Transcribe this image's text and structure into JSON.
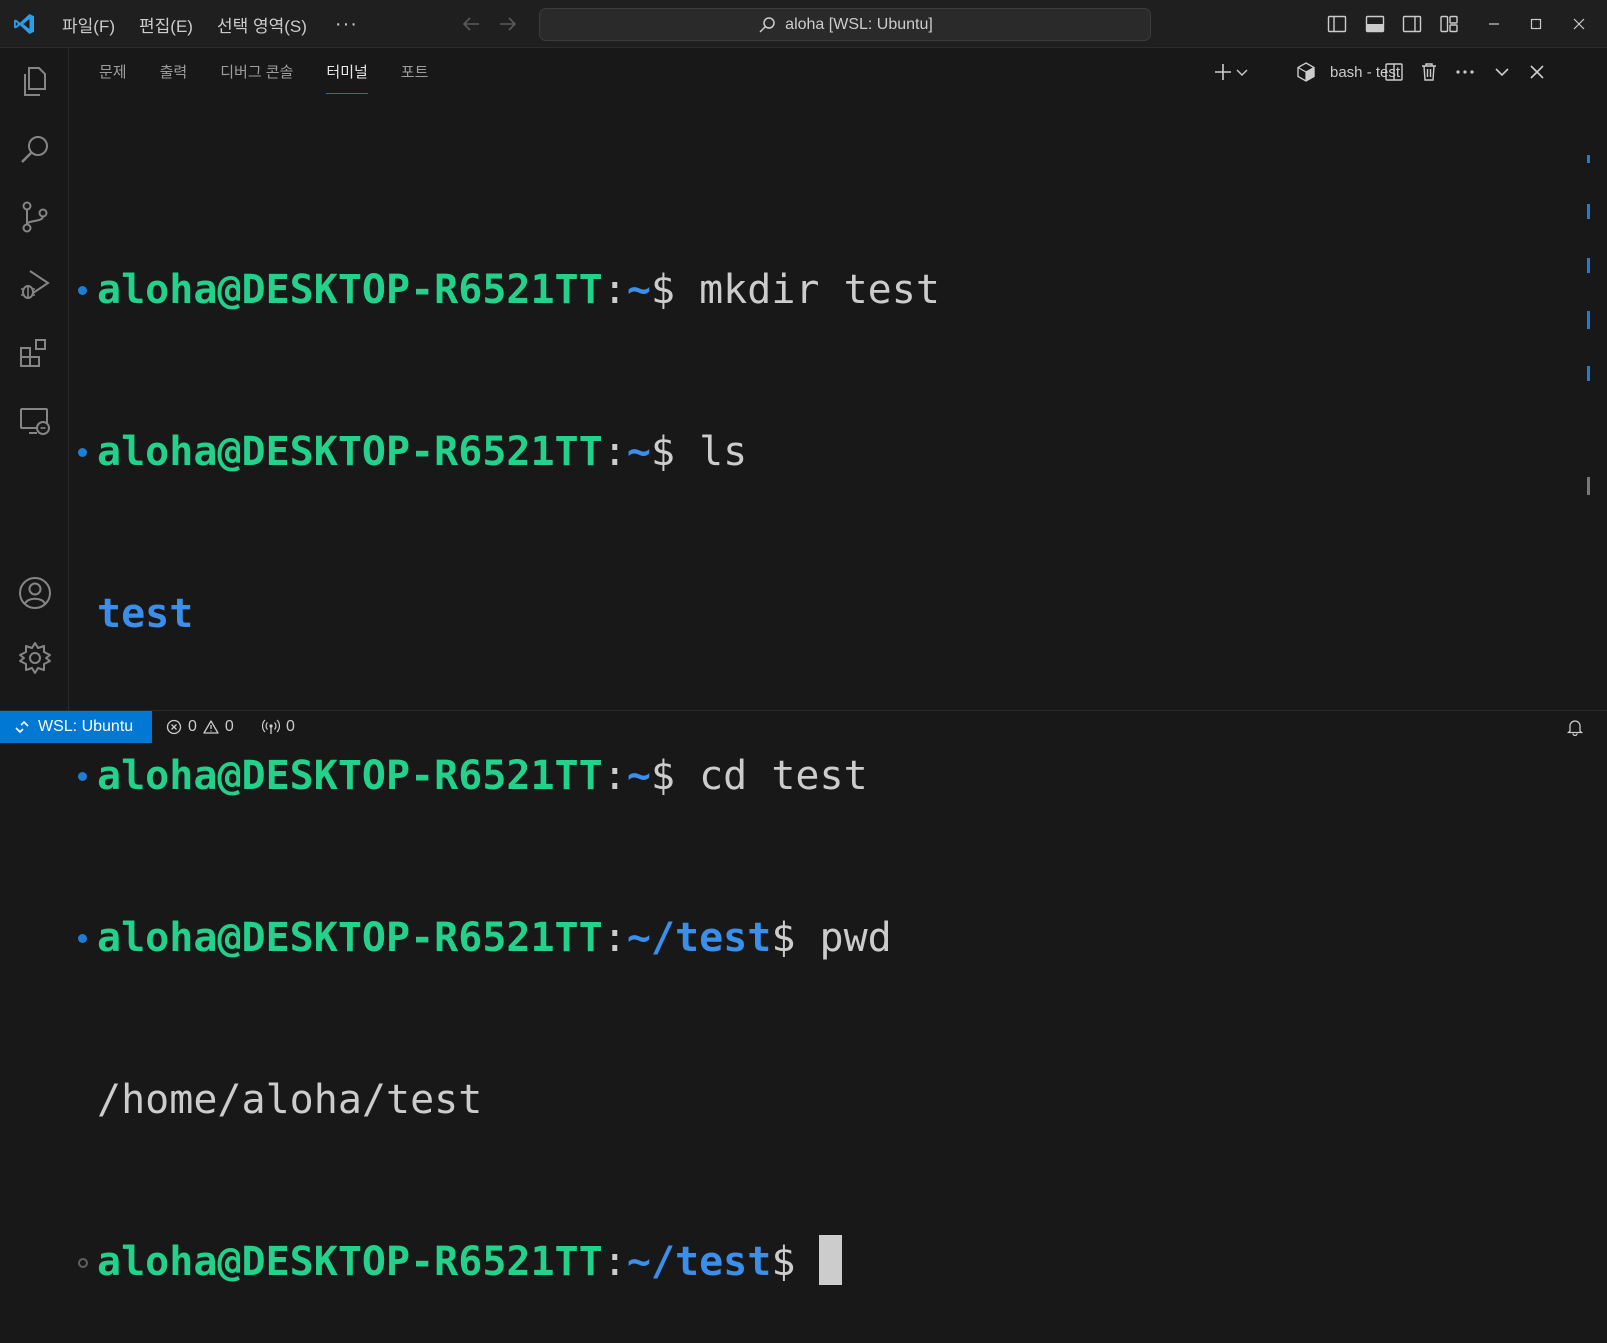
{
  "titlebar": {
    "menu": [
      "파일(F)",
      "편집(E)",
      "선택 영역(S)"
    ],
    "menu_more": "···",
    "search_text": "aloha [WSL: Ubuntu]"
  },
  "panel": {
    "tabs": [
      "문제",
      "출력",
      "디버그 콘솔",
      "터미널",
      "포트"
    ],
    "active_tab": "터미널",
    "terminal_name": "bash - test"
  },
  "terminal": {
    "user_host": "aloha@DESKTOP-R6521TT",
    "lines": [
      {
        "kind": "prompt",
        "cwd": "~",
        "cmd": "mkdir test"
      },
      {
        "kind": "prompt",
        "cwd": "~",
        "cmd": "ls"
      },
      {
        "kind": "output_dir",
        "text": "test"
      },
      {
        "kind": "prompt",
        "cwd": "~",
        "cmd": "cd test"
      },
      {
        "kind": "prompt",
        "cwd": "~/test",
        "cmd": "pwd"
      },
      {
        "kind": "output",
        "text": "/home/aloha/test"
      },
      {
        "kind": "prompt_current",
        "cwd": "~/test",
        "cmd": ""
      }
    ]
  },
  "statusbar": {
    "remote": "WSL: Ubuntu",
    "errors": "0",
    "warnings": "0",
    "ports": "0"
  },
  "colors": {
    "accent": "#0078d4",
    "prompt_user": "#23d18b",
    "prompt_path": "#3b8eea"
  }
}
